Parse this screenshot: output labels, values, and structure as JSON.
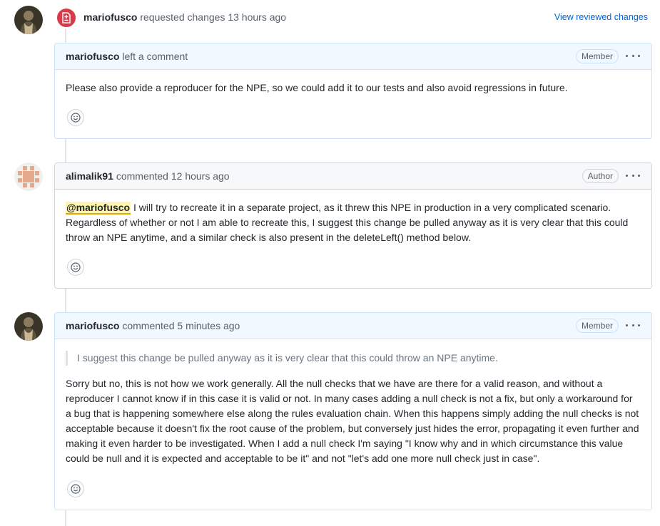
{
  "review": {
    "author": "mariofusco",
    "action": " requested changes 13 hours ago",
    "view_link": "View reviewed changes",
    "badge_icon": "file-diff-icon",
    "badge_color": "#d73a49"
  },
  "comments": [
    {
      "author": "mariofusco",
      "action": " left a comment",
      "role": "Member",
      "body": "Please also provide a reproducer for the NPE, so we could add it to our tests and also avoid regressions in future."
    },
    {
      "author": "alimalik91",
      "action": " commented 12 hours ago",
      "role": "Author",
      "mention": "@mariofusco",
      "body": " I will try to recreate it in a separate project, as it threw this NPE in production in a very complicated scenario. Regardless of whether or not I am able to recreate this, I suggest this change be pulled anyway as it is very clear that this could throw an NPE anytime, and a similar check is also present in the deleteLeft() method below."
    },
    {
      "author": "mariofusco",
      "action": " commented 5 minutes ago",
      "role": "Member",
      "quote": "I suggest this change be pulled anyway as it is very clear that this could throw an NPE anytime.",
      "body": "Sorry but no, this is not how we work generally. All the null checks that we have are there for a valid reason, and without a reproducer I cannot know if in this case it is valid or not. In many cases adding a null check is not a fix, but only a workaround for a bug that is happening somewhere else along the rules evaluation chain. When this happens simply adding the null checks is not acceptable because it doesn't fix the root cause of the problem, but conversely just hides the error, propagating it even further and making it even harder to be investigated. When I add a null check I'm saying \"I know why and in which circumstance this value could be null and it is expected and acceptable to be it\" and not \"let's add one more null check just in case\"."
    }
  ],
  "icons": {
    "reaction": "smiley-icon",
    "menu": "kebab-horizontal-icon"
  },
  "colors": {
    "link": "#0366d6",
    "member_header": "#f1f8ff",
    "author_header": "#f6f8fa",
    "mention_bg": "#fff5b1"
  }
}
